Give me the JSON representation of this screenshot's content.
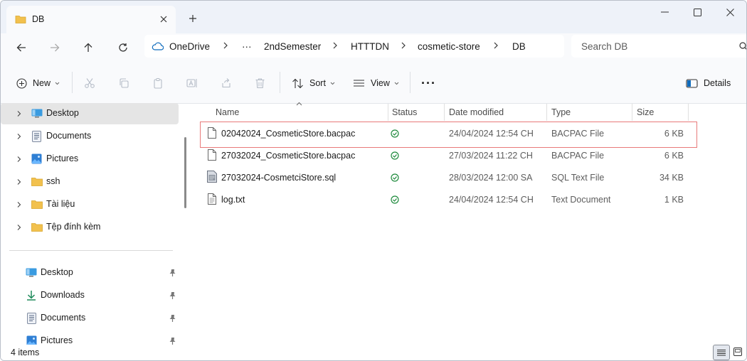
{
  "window": {
    "tab_title": "DB",
    "tab_close": "×",
    "new_tab": "+"
  },
  "nav": {
    "breadcrumb": [
      "OneDrive",
      "···",
      "2ndSemester",
      "HTTTDN",
      "cosmetic-store",
      "DB"
    ],
    "search_placeholder": "Search DB"
  },
  "toolbar": {
    "new_label": "New",
    "sort_label": "Sort",
    "view_label": "View",
    "more_label": "···",
    "details_label": "Details"
  },
  "sidebar": {
    "tree": [
      {
        "label": "Desktop",
        "icon": "desktop-icon"
      },
      {
        "label": "Documents",
        "icon": "documents-icon"
      },
      {
        "label": "Pictures",
        "icon": "pictures-icon"
      },
      {
        "label": "ssh",
        "icon": "folder-icon"
      },
      {
        "label": "Tài liệu",
        "icon": "folder-icon"
      },
      {
        "label": "Tệp đính kèm",
        "icon": "folder-icon"
      }
    ],
    "quick": [
      {
        "label": "Desktop",
        "icon": "desktop-icon"
      },
      {
        "label": "Downloads",
        "icon": "download-icon"
      },
      {
        "label": "Documents",
        "icon": "documents-icon"
      },
      {
        "label": "Pictures",
        "icon": "pictures-icon"
      }
    ]
  },
  "columns": {
    "name": "Name",
    "status": "Status",
    "date": "Date modified",
    "type": "Type",
    "size": "Size"
  },
  "files": [
    {
      "name": "02042024_CosmeticStore.bacpac",
      "date": "24/04/2024 12:54 CH",
      "type": "BACPAC File",
      "size": "6 KB",
      "icon": "file-icon"
    },
    {
      "name": "27032024_CosmeticStore.bacpac",
      "date": "27/03/2024 11:22 CH",
      "type": "BACPAC File",
      "size": "6 KB",
      "icon": "file-icon"
    },
    {
      "name": "27032024-CosmetciStore.sql",
      "date": "28/03/2024 12:00 SA",
      "type": "SQL Text File",
      "size": "34 KB",
      "icon": "sql-file-icon"
    },
    {
      "name": "log.txt",
      "date": "24/04/2024 12:54 CH",
      "type": "Text Document",
      "size": "1 KB",
      "icon": "text-file-icon"
    }
  ],
  "status_bar": {
    "item_count": "4 items"
  },
  "colors": {
    "accent": "#0f6cbd",
    "folder": "#f2c14e",
    "status_ok": "#1e8a3c",
    "highlight_border": "#e87a7a"
  }
}
